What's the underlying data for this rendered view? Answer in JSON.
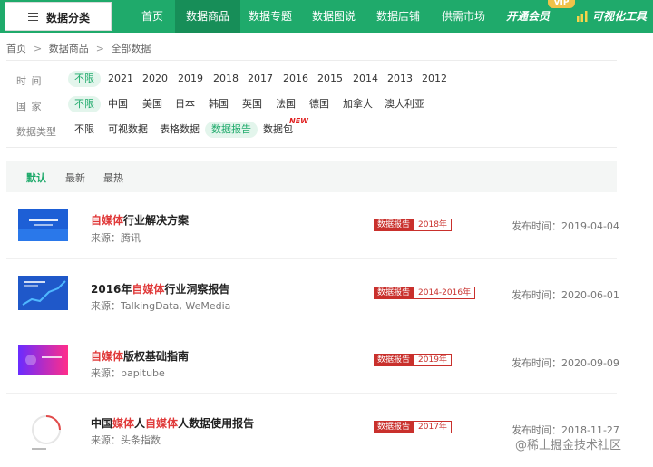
{
  "topbar": {
    "category_label": "数据分类",
    "nav": [
      "首页",
      "数据商品",
      "数据专题",
      "数据图说",
      "数据店铺",
      "供需市场"
    ],
    "vip_label": "开通会员",
    "vip_badge": "VIP",
    "tools_label": "可视化工具",
    "brand_color": "#1faa6b"
  },
  "breadcrumb": [
    "首页",
    "数据商品",
    "全部数据"
  ],
  "filters": {
    "time": {
      "label": "时 间",
      "options": [
        "不限",
        "2021",
        "2020",
        "2019",
        "2018",
        "2017",
        "2016",
        "2015",
        "2014",
        "2013",
        "2012"
      ],
      "selected": "不限"
    },
    "country": {
      "label": "国 家",
      "options": [
        "不限",
        "中国",
        "美国",
        "日本",
        "韩国",
        "英国",
        "法国",
        "德国",
        "加拿大",
        "澳大利亚"
      ],
      "selected": "不限"
    },
    "type": {
      "label": "数据类型",
      "options": [
        "不限",
        "可视数据",
        "表格数据",
        "数据报告",
        "数据包"
      ],
      "selected": "数据报告",
      "new_badge": "NEW"
    }
  },
  "sort": {
    "options": [
      "默认",
      "最新",
      "最热"
    ],
    "active": "默认"
  },
  "items": [
    {
      "title_parts": [
        "",
        "自媒体",
        "行业解决方案"
      ],
      "source": "来源：腾讯",
      "tag_type": "数据报告",
      "tag_year": "2018年",
      "date": "发布时间：2019-04-04"
    },
    {
      "title_parts": [
        "2016年",
        "自媒体",
        "行业洞察报告"
      ],
      "source": "来源：TalkingData, WeMedia",
      "tag_type": "数据报告",
      "tag_year": "2014-2016年",
      "date": "发布时间：2020-06-01"
    },
    {
      "title_parts": [
        "",
        "自媒体",
        "版权基础指南"
      ],
      "source": "来源：papitube",
      "tag_type": "数据报告",
      "tag_year": "2019年",
      "date": "发布时间：2020-09-09"
    },
    {
      "title_parts": [
        "中国",
        "媒体",
        "人",
        "自媒体",
        "人数据使用报告"
      ],
      "source": "来源：头条指数",
      "tag_type": "数据报告",
      "tag_year": "2017年",
      "date": "发布时间：2018-11-27"
    }
  ],
  "watermark": "@稀土掘金技术社区"
}
